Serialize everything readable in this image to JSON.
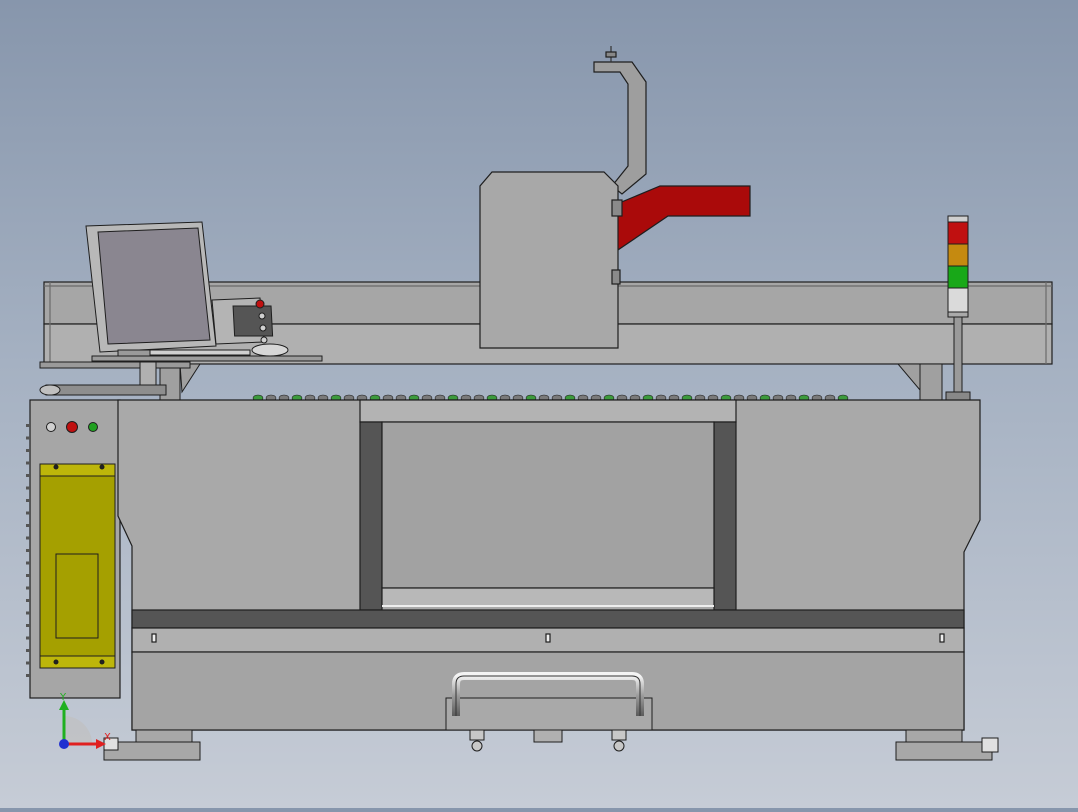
{
  "scene": {
    "subject": "machine-front-view",
    "colors": {
      "body": "#a9a9a9",
      "body_dark": "#555555",
      "outline": "#1e1e1e",
      "accent_red": "#aa0a0a",
      "cabinet_yellow": "#a5a000",
      "monitor_screen": "#8a8690",
      "lamp_red": "#c01010",
      "lamp_amber": "#c58a10",
      "lamp_green": "#18a818",
      "lamp_white": "#dadada",
      "button_red": "#c01010",
      "button_green": "#20a020"
    },
    "control_buttons": [
      {
        "icon": "power-symbol-icon",
        "color": "#d0d0d0"
      },
      {
        "icon": "emergency-stop-icon",
        "color": "#c01010"
      },
      {
        "icon": "start-button-icon",
        "color": "#20a020"
      }
    ],
    "signal_tower_levels": [
      "red",
      "amber",
      "green",
      "white"
    ]
  },
  "triad": {
    "x_label": "X",
    "y_label": "Y",
    "x_color": "#e02020",
    "y_color": "#20b020",
    "z_color": "#2030d0"
  }
}
